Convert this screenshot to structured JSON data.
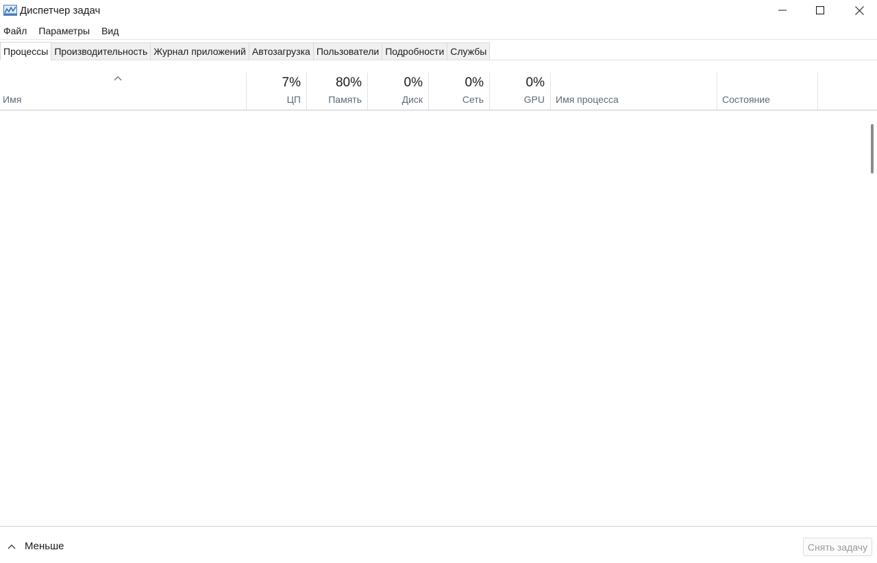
{
  "window": {
    "title": "Диспетчер задач"
  },
  "menu": {
    "items": [
      "Файл",
      "Параметры",
      "Вид"
    ]
  },
  "tabs": [
    {
      "label": "Процессы",
      "active": true
    },
    {
      "label": "Производительность",
      "active": false
    },
    {
      "label": "Журнал приложений",
      "active": false
    },
    {
      "label": "Автозагрузка",
      "active": false
    },
    {
      "label": "Пользователи",
      "active": false
    },
    {
      "label": "Подробности",
      "active": false
    },
    {
      "label": "Службы",
      "active": false
    }
  ],
  "columns": {
    "name": {
      "label": "Имя"
    },
    "cpu": {
      "percent": "7%",
      "label": "ЦП"
    },
    "memory": {
      "percent": "80%",
      "label": "Память"
    },
    "disk": {
      "percent": "0%",
      "label": "Диск"
    },
    "network": {
      "percent": "0%",
      "label": "Сеть"
    },
    "gpu": {
      "percent": "0%",
      "label": "GPU"
    },
    "process_name": {
      "label": "Имя процесса"
    },
    "status": {
      "label": "Состояние"
    }
  },
  "footer": {
    "less_label": "Меньше",
    "end_task_label": "Снять задачу"
  },
  "icons": {
    "app": "task-manager-icon",
    "minimize": "minimize-icon",
    "maximize": "maximize-icon",
    "close": "close-icon",
    "sort": "chevron-up-icon",
    "less": "chevron-up-icon"
  },
  "colors": {
    "header_label": "#5a6a7a",
    "disabled_text": "#9a9a9a",
    "scroll_thumb": "#8c8c8c"
  }
}
